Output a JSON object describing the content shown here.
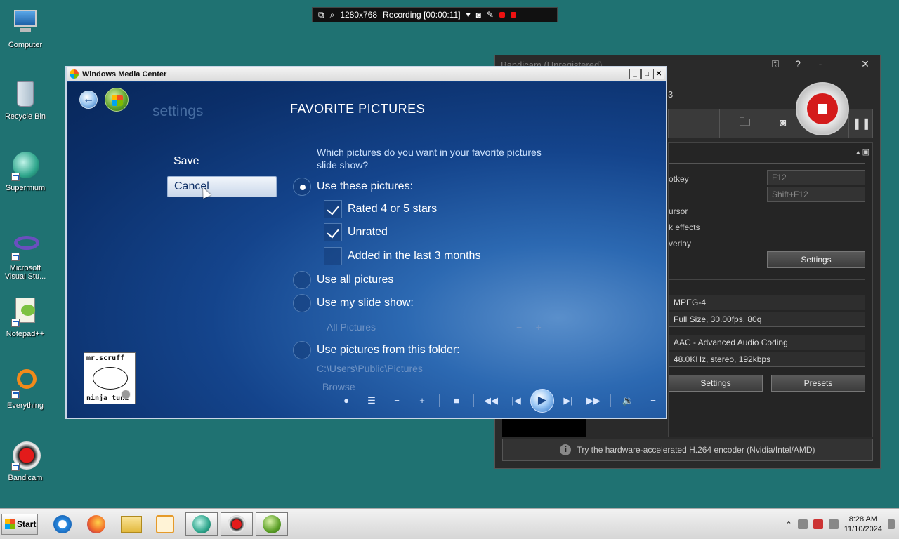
{
  "desktop": {
    "icons": [
      {
        "label": "Computer"
      },
      {
        "label": "Recycle Bin"
      },
      {
        "label": "Supermium"
      },
      {
        "label": "Microsoft Visual Stu..."
      },
      {
        "label": "Notepad++"
      },
      {
        "label": "Everything"
      },
      {
        "label": "Bandicam"
      }
    ]
  },
  "recorder_bar": {
    "resolution": "1280x768",
    "status": "Recording [00:00:11]"
  },
  "bandicam": {
    "title": "Bandicam (Unregistered)",
    "version_fragment": "3",
    "labels": {
      "hotkey": "otkey",
      "cursor": "ursor",
      "click_effects": "k effects",
      "overlay": "verlay"
    },
    "fields": {
      "hotkey_record": "F12",
      "hotkey_pause": "Shift+F12",
      "video_codec": "MPEG-4",
      "video_detail": "Full Size, 30.00fps, 80q",
      "audio_codec": "AAC - Advanced Audio Coding",
      "audio_detail": "48.0KHz, stereo, 192kbps"
    },
    "buttons": {
      "settings_top": "Settings",
      "settings_bottom": "Settings",
      "presets": "Presets"
    },
    "info": "Try the hardware-accelerated H.264 encoder (Nvidia/Intel/AMD)"
  },
  "wmc": {
    "title": "Windows Media Center",
    "section": "settings",
    "page_title": "FAVORITE PICTURES",
    "menu": {
      "save": "Save",
      "cancel": "Cancel"
    },
    "question": "Which pictures do you want in your favorite pictures slide show?",
    "options": {
      "use_these": "Use these pictures:",
      "rated": "Rated 4 or 5 stars",
      "unrated": "Unrated",
      "added_recent": "Added in the last 3 months",
      "use_all": "Use all pictures",
      "use_slideshow": "Use my slide show:",
      "slideshow_value": "All Pictures",
      "use_folder": "Use pictures from this folder:",
      "folder_path": "C:\\Users\\Public\\Pictures",
      "browse": "Browse"
    },
    "selected_option": "use_these",
    "checked": {
      "rated": true,
      "unrated": true,
      "added_recent": false
    },
    "album_art": {
      "top_text": "mr.scruff",
      "bottom_text": "ninja tuna"
    }
  },
  "taskbar": {
    "start_label": "Start",
    "time": "8:28 AM",
    "date": "11/10/2024"
  },
  "colors": {
    "desktop": "#1f7272",
    "wmc_blue": "#0d3e84",
    "record_red": "#d41b1b"
  }
}
